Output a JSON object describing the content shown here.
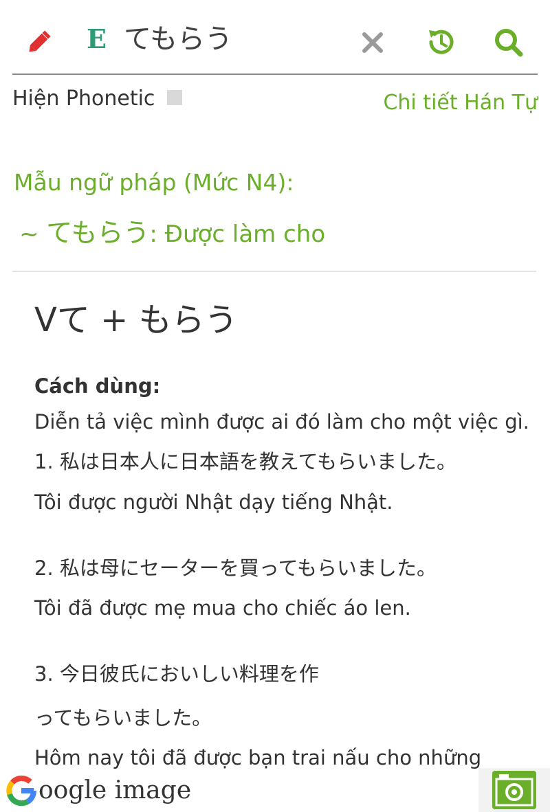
{
  "search": {
    "language_badge": "E",
    "query": "てもらう"
  },
  "icons": {
    "edit": "pencil-icon",
    "clear": "close-icon",
    "history": "history-icon",
    "search": "search-icon",
    "google": "google-g-icon",
    "camera": "camera-icon"
  },
  "options": {
    "phonetic_label": "Hiện Phonetic",
    "phonetic_checked": false,
    "kanji_detail_link": "Chi tiết Hán Tự"
  },
  "grammar": {
    "level_title": "Mẫu ngữ pháp (Mức N4):",
    "pattern_prefix": "~ ",
    "pattern_jp": "てもらう",
    "pattern_meaning": ": Được làm cho"
  },
  "content": {
    "formula": "Vて  +  もらう",
    "usage_label": "Cách dùng:",
    "usage_desc": "Diễn tả việc mình được ai đó làm cho một việc gì.",
    "examples": [
      {
        "jp_lines": [
          "1. 私は日本人に日本語を教えてもらいました。"
        ],
        "vi_lines": [
          "Tôi được người Nhật dạy tiếng Nhật."
        ]
      },
      {
        "jp_lines": [
          "2. 私は母にセーターを買ってもらいました。"
        ],
        "vi_lines": [
          "Tôi đã được mẹ mua cho chiếc áo len."
        ]
      },
      {
        "jp_lines": [
          "3. 今日彼氏においしい料理を作",
          "ってもらいました。"
        ],
        "vi_lines": [
          "Hôm nay tôi đã được bạn trai nấu cho những"
        ]
      }
    ]
  },
  "bottom": {
    "google_image_text": "oogle image"
  },
  "colors": {
    "accent_green": "#6aae2a",
    "badge_teal": "#2e9c77",
    "edit_red": "#e03030",
    "icon_gray": "#9a9a9a"
  }
}
